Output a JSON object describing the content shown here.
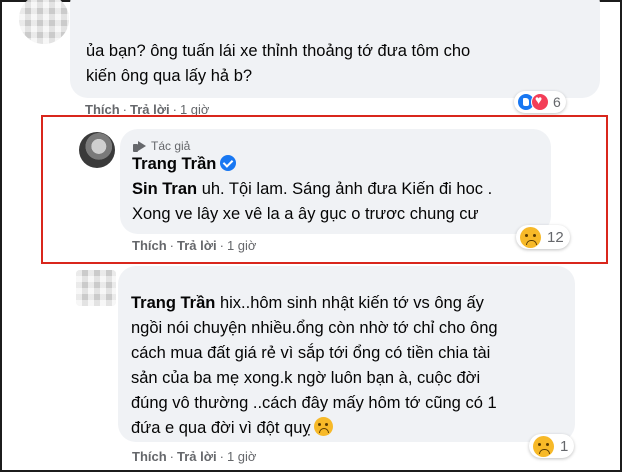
{
  "comment1": {
    "text": "ủa bạn? ông tuấn lái xe thỉnh thoảng tớ đưa tôm cho kiến ông qua lấy hả b?",
    "line1": "ủa bạn? ông tuấn lái xe thỉnh thoảng tớ đưa tôm cho",
    "line2": "kiến ông qua lấy hả b?",
    "like_label": "Thích",
    "reply_label": "Trả lời",
    "time": "1 giờ",
    "reaction_count": "6",
    "reactions": [
      "like-icon",
      "love-icon"
    ]
  },
  "comment2": {
    "author_badge": "Tác giả",
    "author": "Trang Trần",
    "verified": true,
    "mention": "Sin Tran",
    "line1_rest": " uh. Tội lam. Sáng ảnh đưa Kiến đi hoc .",
    "line2": "Xong ve lây xe vê la a ây gục o trươc chung cư",
    "like_label": "Thích",
    "reply_label": "Trả lời",
    "time": "1 giờ",
    "reaction_count": "12",
    "reactions": [
      "sad-icon"
    ],
    "highlight_color": "#d9261c"
  },
  "comment3": {
    "author": "Trang Trần",
    "line1_rest": " hix..hôm sinh nhật kiến tớ vs ông ấy",
    "line2": "ngồi nói chuyện nhiều.ổng còn nhờ tớ chỉ cho ông",
    "line3": "cách mua đất giá rẻ vì sắp tới ổng có tiền chia tài",
    "line4": "sản của ba mẹ xong.k ngờ luôn bạn à, cuộc đời",
    "line5": "đúng vô thường ..cách đây mấy hôm tớ cũng có 1",
    "line6": "đứa e qua đời vì đột quỵ",
    "like_label": "Thích",
    "reply_label": "Trả lời",
    "time": "1 giờ",
    "reaction_count": "1",
    "reactions": [
      "sad-icon"
    ]
  },
  "colors": {
    "bubble": "#f0f2f5",
    "meta_text": "#65676b",
    "facebook_blue": "#1877f2",
    "love_red": "#f33e58",
    "sad_yellow": "#f7b928"
  }
}
